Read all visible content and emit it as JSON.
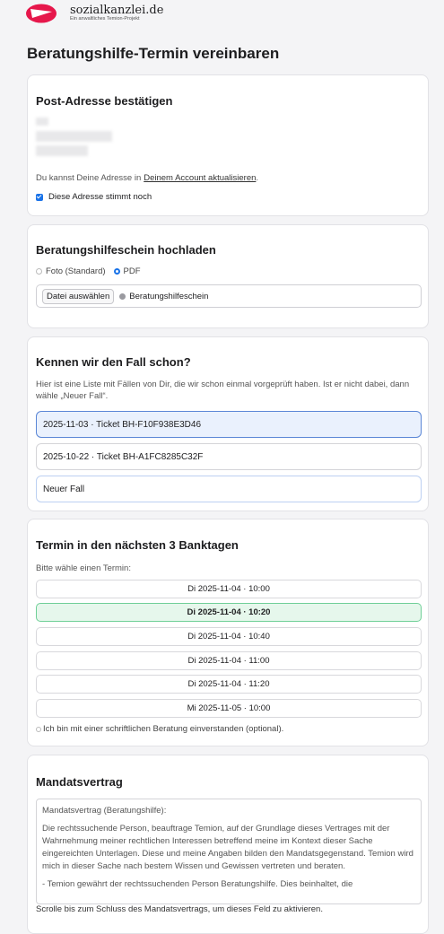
{
  "header": {
    "logo_name": "sozialkanzlei.de",
    "logo_sub": "Ein anwaltliches Temion-Projekt"
  },
  "page": {
    "title": "Beratungshilfe-Termin vereinbaren"
  },
  "address": {
    "title": "Post-Adresse bestätigen",
    "hint_prefix": "Du kannst Deine Adresse in ",
    "hint_link": "Deinem Account aktualisieren",
    "hint_suffix": ".",
    "confirm_label": "Diese Adresse stimmt noch",
    "confirm_checked": true
  },
  "upload": {
    "title": "Beratungshilfeschein hochladen",
    "options": [
      "Foto (Standard)",
      "PDF"
    ],
    "selected": "PDF",
    "file_button": "Datei auswählen",
    "file_name": "Beratungshilfeschein"
  },
  "cases": {
    "title": "Kennen wir den Fall schon?",
    "description": "Hier ist eine Liste mit Fällen von Dir, die wir schon einmal vorgeprüft haben. Ist er nicht dabei, dann wähle „Neuer Fall“.",
    "items": [
      "2025-11-03 · Ticket BH-F10F938E3D46",
      "2025-10-22 · Ticket BH-A1FC8285C32F",
      "Neuer Fall"
    ],
    "selected_index": 0
  },
  "appointment": {
    "title": "Termin in den nächsten 3 Banktagen",
    "prompt": "Bitte wähle einen Termin:",
    "slots": [
      "Di 2025-11-04 · 10:00",
      "Di 2025-11-04 · 10:20",
      "Di 2025-11-04 · 10:40",
      "Di 2025-11-04 · 11:00",
      "Di 2025-11-04 · 11:20",
      "Mi 2025-11-05 · 10:00"
    ],
    "selected_index": 1,
    "written_consent": "Ich bin mit einer schriftlichen Beratung einverstanden (optional)."
  },
  "mandate": {
    "title": "Mandatsvertrag",
    "text_heading": "Mandatsvertrag (Beratungshilfe):",
    "text_p1": "Die rechtssuchende Person, beauftrage Temion, auf der Grundlage dieses Vertrages mit der Wahrnehmung meiner rechtlichen Interessen betreffend meine im Kontext dieser Sache eingereichten Unterlagen. Diese und meine Angaben bilden den Mandatsgegenstand. Temion wird mich in dieser Sache nach bestem Wissen und Gewissen vertreten und beraten.",
    "text_p2": "- Temion gewährt der rechtssuchenden Person Beratungshilfe. Dies beinhaltet, die",
    "scroll_hint": "Scrolle bis zum Schluss des Mandatsvertrags, um dieses Feld zu aktivieren."
  },
  "colors": {
    "accent": "#1a73e8",
    "brand": "#e6174b",
    "selected_slot": "#e6f7ec",
    "selected_case": "#eaf1fd"
  }
}
